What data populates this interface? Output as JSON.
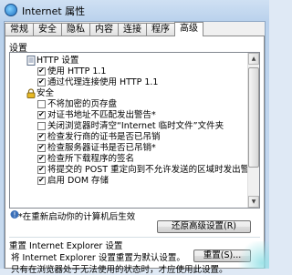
{
  "window": {
    "title": "Internet 属性"
  },
  "tabs": [
    "常规",
    "安全",
    "隐私",
    "内容",
    "连接",
    "程序",
    "高级"
  ],
  "active_tab": "高级",
  "settings": {
    "label": "设置",
    "items": [
      {
        "type": "category",
        "text": "HTTP 设置",
        "icon": "page-icon"
      },
      {
        "type": "checkbox",
        "checked": true,
        "text": "使用 HTTP 1.1"
      },
      {
        "type": "checkbox",
        "checked": true,
        "text": "通过代理连接使用 HTTP 1.1"
      },
      {
        "type": "category",
        "text": "安全",
        "icon": "lock-icon"
      },
      {
        "type": "checkbox",
        "checked": false,
        "text": "不将加密的页存盘"
      },
      {
        "type": "checkbox",
        "checked": true,
        "text": "对证书地址不匹配发出警告*"
      },
      {
        "type": "checkbox",
        "checked": false,
        "text": "关闭浏览器时清空“Internet 临时文件”文件夹"
      },
      {
        "type": "checkbox",
        "checked": true,
        "text": "检查发行商的证书是否已吊销"
      },
      {
        "type": "checkbox",
        "checked": true,
        "text": "检查服务器证书是否已吊销*"
      },
      {
        "type": "checkbox",
        "checked": true,
        "text": "检查所下载程序的签名"
      },
      {
        "type": "checkbox",
        "checked": true,
        "text": "将提交的 POST 重定向到不允许发送的区域时发出警"
      },
      {
        "type": "checkbox",
        "checked": true,
        "text": "启用 DOM 存储"
      }
    ]
  },
  "restart_note": "*在重新启动你的计算机后生效",
  "restore_button": "还原高级设置(R)",
  "reset": {
    "heading": "重置 Internet Explorer 设置",
    "description": "将 Internet Explorer 设置重置为默认设置。",
    "button": "重置(S)...",
    "footer": "只有在浏览器处于无法使用的状态时，才应使用此设置。"
  }
}
